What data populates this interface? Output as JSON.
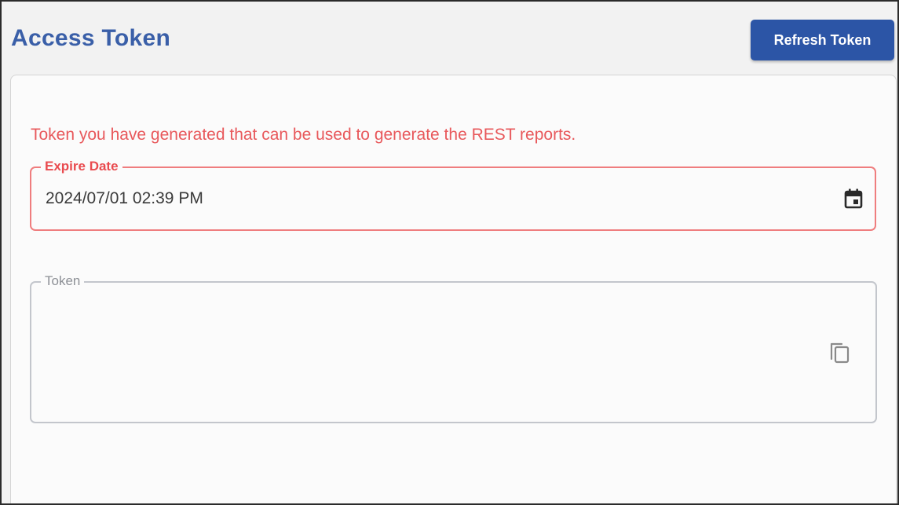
{
  "header": {
    "title": "Access Token",
    "refresh_label": "Refresh Token"
  },
  "card": {
    "description": "Token you have generated that can be used to generate the REST reports.",
    "expire_date": {
      "label": "Expire Date",
      "value": "2024/07/01 02:39 PM",
      "icon": "calendar-icon"
    },
    "token": {
      "label": "Token",
      "value": "",
      "icon": "copy-icon"
    }
  },
  "colors": {
    "primary": "#2c55a6",
    "title": "#3a5fa8",
    "error": "#e94b4f",
    "border_neutral": "#c3c6cc"
  }
}
